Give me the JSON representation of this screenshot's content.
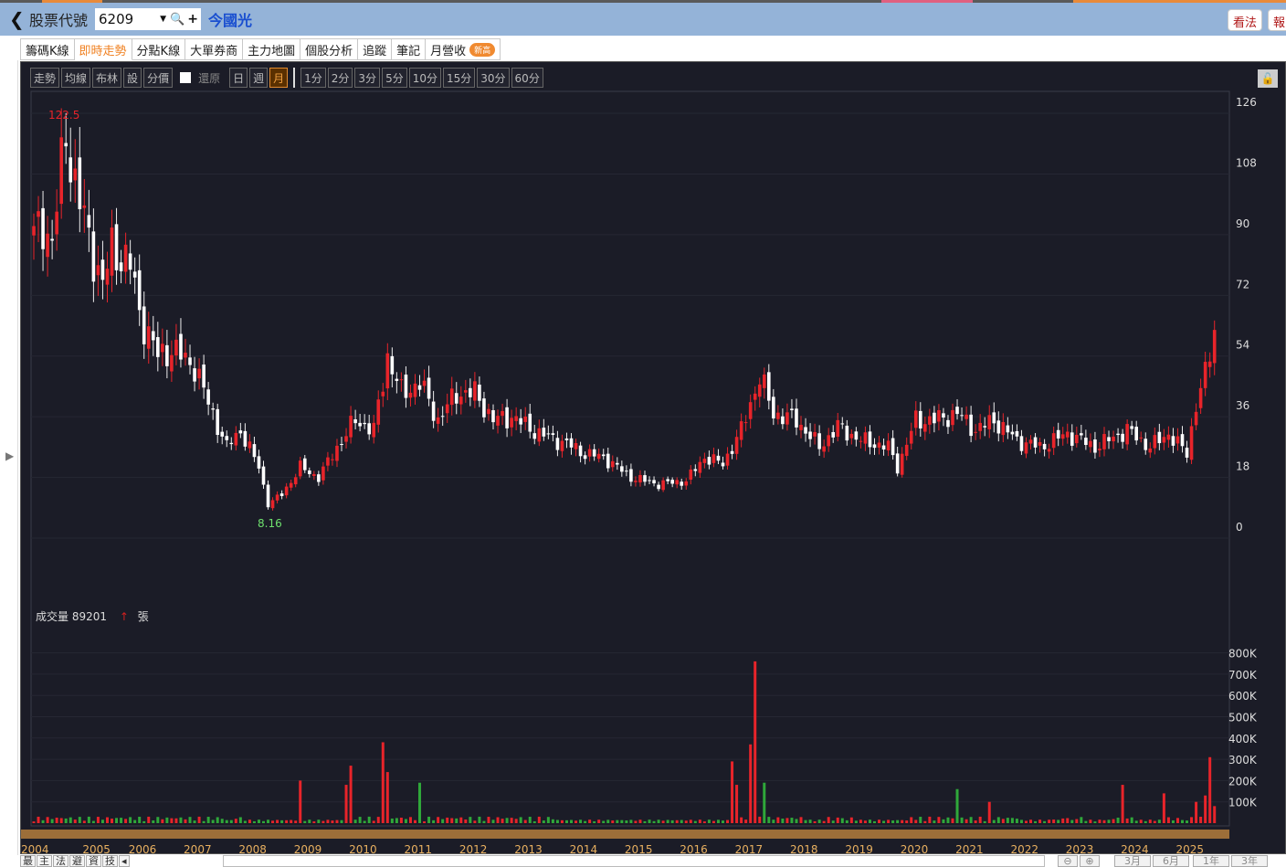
{
  "header": {
    "back_icon": "chevron-left-icon",
    "code_label": "股票代號",
    "code_value": "6209",
    "stock_name": "今國光",
    "buttons": [
      "看法",
      "報"
    ]
  },
  "tabs": [
    {
      "label": "籌碼K線"
    },
    {
      "label": "即時走勢",
      "active": true
    },
    {
      "label": "分點K線"
    },
    {
      "label": "大單券商"
    },
    {
      "label": "主力地圖"
    },
    {
      "label": "個股分析"
    },
    {
      "label": "追蹤"
    },
    {
      "label": "筆記"
    },
    {
      "label": "月營收",
      "badge": "新高"
    }
  ],
  "toolbar": {
    "left": [
      "走勢",
      "均線",
      "布林",
      "設",
      "分價"
    ],
    "restore_label": "還原",
    "periods": [
      "日",
      "週",
      "月"
    ],
    "active_period": "月",
    "minutes": [
      "1分",
      "2分",
      "3分",
      "5分",
      "10分",
      "15分",
      "30分",
      "60分"
    ]
  },
  "volume_info": {
    "label": "成交量",
    "value": "89201",
    "unit": "張"
  },
  "bottom": {
    "tabs": [
      "最",
      "主",
      "法",
      "避",
      "資",
      "技"
    ],
    "ranges": [
      "3月",
      "6月",
      "1年",
      "3年"
    ]
  },
  "colors": {
    "up": "#e8242a",
    "down": "#2fa83a",
    "bg": "#1b1c27"
  },
  "chart_data": {
    "type": "candlestick",
    "interval": "monthly",
    "start_year": 2004,
    "price_axis": {
      "ticks": [
        0,
        18,
        36,
        54,
        72,
        90,
        108,
        126
      ],
      "range": [
        0,
        126
      ]
    },
    "volume_axis": {
      "ticks": [
        "100K",
        "200K",
        "300K",
        "400K",
        "500K",
        "600K",
        "700K",
        "800K"
      ],
      "range_k": [
        0,
        800
      ]
    },
    "year_labels": [
      "2004",
      "2005",
      "2006",
      "2007",
      "2008",
      "2009",
      "2010",
      "2011",
      "2012",
      "2013",
      "2014",
      "2015",
      "2016",
      "2017",
      "2018",
      "2019",
      "2020",
      "2021",
      "2022",
      "2023",
      "2024",
      "2025"
    ],
    "high_label": "122.5",
    "low_label": "8.16",
    "close_keypoints": [
      [
        0,
        89
      ],
      [
        2,
        94
      ],
      [
        4,
        87
      ],
      [
        7,
        121
      ],
      [
        9,
        105
      ],
      [
        12,
        89
      ],
      [
        15,
        75
      ],
      [
        17,
        86
      ],
      [
        21,
        81
      ],
      [
        23,
        67
      ],
      [
        27,
        54
      ],
      [
        30,
        56
      ],
      [
        35,
        51
      ],
      [
        38,
        40
      ],
      [
        42,
        27
      ],
      [
        45,
        32
      ],
      [
        49,
        21
      ],
      [
        51,
        10
      ],
      [
        54,
        13
      ],
      [
        58,
        21
      ],
      [
        62,
        18
      ],
      [
        66,
        27
      ],
      [
        70,
        35
      ],
      [
        74,
        32
      ],
      [
        77,
        54
      ],
      [
        80,
        43
      ],
      [
        84,
        46
      ],
      [
        88,
        35
      ],
      [
        92,
        43
      ],
      [
        96,
        43
      ],
      [
        100,
        35
      ],
      [
        104,
        36
      ],
      [
        110,
        31
      ],
      [
        116,
        28
      ],
      [
        120,
        25
      ],
      [
        124,
        24
      ],
      [
        130,
        18
      ],
      [
        136,
        16
      ],
      [
        142,
        17
      ],
      [
        146,
        24
      ],
      [
        150,
        22
      ],
      [
        154,
        32
      ],
      [
        156,
        40
      ],
      [
        158,
        48
      ],
      [
        161,
        37
      ],
      [
        166,
        35
      ],
      [
        171,
        27
      ],
      [
        175,
        33
      ],
      [
        180,
        29
      ],
      [
        186,
        27
      ],
      [
        188,
        21
      ],
      [
        192,
        35
      ],
      [
        196,
        35
      ],
      [
        201,
        37
      ],
      [
        205,
        32
      ],
      [
        209,
        35
      ],
      [
        214,
        29
      ],
      [
        219,
        27
      ],
      [
        225,
        31
      ],
      [
        231,
        27
      ],
      [
        238,
        32
      ],
      [
        243,
        27
      ],
      [
        247,
        31
      ],
      [
        251,
        25
      ],
      [
        253,
        40
      ],
      [
        255,
        48
      ],
      [
        257,
        62
      ]
    ],
    "volume_spikes_k": [
      [
        58,
        200,
        "up"
      ],
      [
        68,
        180,
        "up"
      ],
      [
        69,
        270,
        "up"
      ],
      [
        76,
        380,
        "up"
      ],
      [
        77,
        240,
        "up"
      ],
      [
        84,
        190,
        "down"
      ],
      [
        152,
        290,
        "up"
      ],
      [
        153,
        180,
        "up"
      ],
      [
        156,
        370,
        "up"
      ],
      [
        157,
        760,
        "up"
      ],
      [
        159,
        190,
        "down"
      ],
      [
        201,
        160,
        "down"
      ],
      [
        208,
        100,
        "up"
      ],
      [
        237,
        180,
        "up"
      ],
      [
        246,
        140,
        "up"
      ],
      [
        253,
        100,
        "up"
      ],
      [
        255,
        130,
        "up"
      ],
      [
        256,
        310,
        "up"
      ],
      [
        257,
        80,
        "up"
      ]
    ]
  }
}
